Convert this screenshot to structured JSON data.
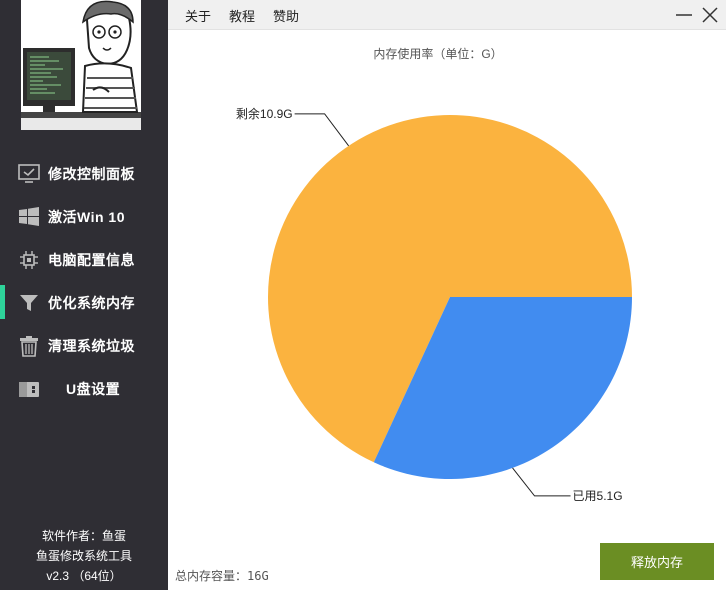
{
  "menu": {
    "about": "关于",
    "tutorial": "教程",
    "donate": "赞助"
  },
  "sidebar": {
    "items": [
      {
        "label": "修改控制面板",
        "icon": "monitor-check-icon"
      },
      {
        "label": "激活Win 10",
        "icon": "windows-icon"
      },
      {
        "label": "电脑配置信息",
        "icon": "cpu-chip-icon"
      },
      {
        "label": "优化系统内存",
        "icon": "funnel-icon",
        "active": true
      },
      {
        "label": "清理系统垃圾",
        "icon": "trash-icon"
      },
      {
        "label": "U盘设置",
        "icon": "usb-drive-icon"
      }
    ],
    "footer": {
      "author": "软件作者：鱼蛋",
      "app_name": "鱼蛋修改系统工具",
      "version": "v2.3 （64位）"
    }
  },
  "colors": {
    "sidebar_bg": "#2f2e34",
    "active_accent": "#2ed39a",
    "remaining": "#fbb33f",
    "used": "#418cf0",
    "release_button": "#6b8e23"
  },
  "chart_data": {
    "type": "pie",
    "title": "内存使用率（单位：G）",
    "slices": [
      {
        "label": "剩余10.9G",
        "name": "剩余",
        "value": 10.9,
        "color": "#fbb33f"
      },
      {
        "label": "已用5.1G",
        "name": "已用",
        "value": 5.1,
        "color": "#418cf0"
      }
    ]
  },
  "total_capacity": "总内存容量：16G",
  "release_button": "释放内存"
}
